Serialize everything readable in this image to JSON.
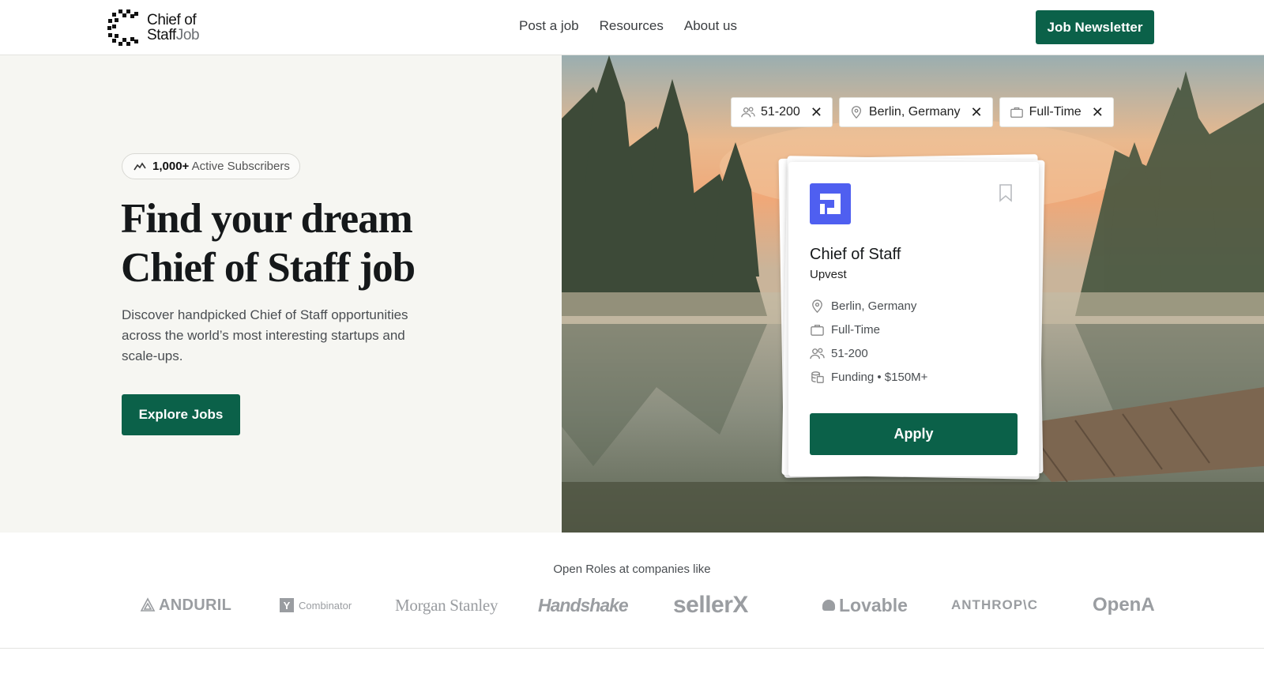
{
  "header": {
    "logo_line1": "Chief of",
    "logo_line2_bold": "Staff",
    "logo_line2_light": "Job",
    "nav": [
      {
        "label": "Post a job"
      },
      {
        "label": "Resources"
      },
      {
        "label": "About us"
      }
    ],
    "newsletter_label": "Job Newsletter"
  },
  "hero": {
    "badge_count": "1,000+",
    "badge_text": "Active Subscribers",
    "title_line1": "Find your dream",
    "title_line2": "Chief of Staff job",
    "subtitle": "Discover handpicked Chief of Staff opportunities across the world’s most interesting startups and scale-ups.",
    "cta_label": "Explore Jobs"
  },
  "filters": [
    {
      "icon": "people-icon",
      "label": "51-200",
      "remove": "✕"
    },
    {
      "icon": "location-pin-icon",
      "label": "Berlin, Germany",
      "remove": "✕"
    },
    {
      "icon": "briefcase-icon",
      "label": "Full-Time",
      "remove": "✕"
    }
  ],
  "job_card": {
    "title": "Chief of Staff",
    "company": "Upvest",
    "location": "Berlin, Germany",
    "employment_type": "Full-Time",
    "company_size": "51-200",
    "funding": "Funding • $150M+",
    "apply_label": "Apply",
    "logo_color": "#4f5ff0"
  },
  "companies": {
    "caption": "Open Roles at companies like",
    "list": [
      {
        "name": "ANDURIL"
      },
      {
        "name": "Combinator",
        "badge": "Y"
      },
      {
        "name": "Morgan Stanley"
      },
      {
        "name": "Handshake"
      },
      {
        "name": "sellerX"
      },
      {
        "name": "Lovable"
      },
      {
        "name": "ANTHROP\\C"
      },
      {
        "name": "OpenAI"
      }
    ]
  },
  "colors": {
    "brand_green": "#0b6149",
    "hero_left_bg": "#f6f6f2",
    "logo_grey": "#9a9da1"
  }
}
